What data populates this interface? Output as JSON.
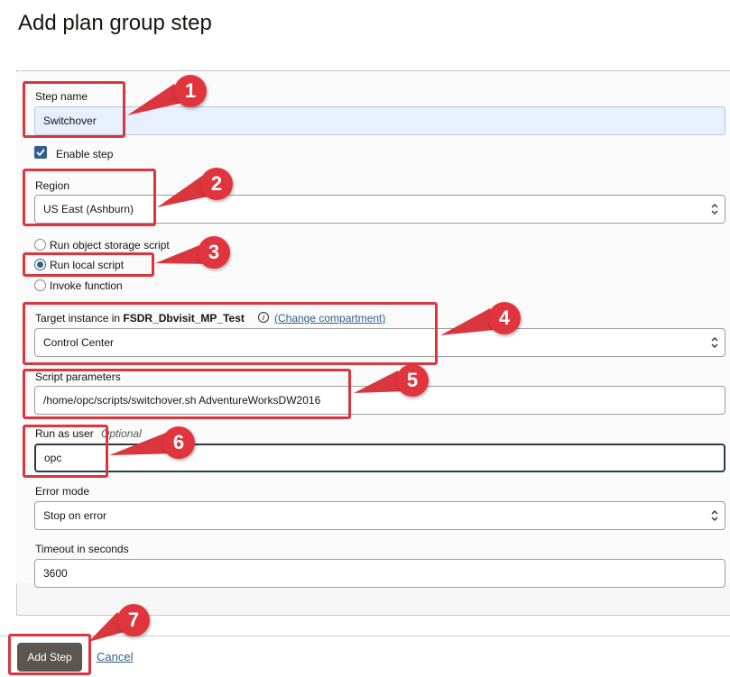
{
  "page_title": "Add plan group step",
  "form": {
    "step_name_label": "Step name",
    "step_name_value": "Switchover",
    "enable_step_label": "Enable step",
    "region_label": "Region",
    "region_value": "US East (Ashburn)",
    "radio_options": [
      "Run object storage script",
      "Run local script",
      "Invoke function"
    ],
    "target_instance_label": "Target instance in",
    "target_compartment": "FSDR_Dbvisit_MP_Test",
    "change_compartment_link": "(Change compartment)",
    "target_instance_value": "Control Center",
    "script_params_label": "Script parameters",
    "script_params_value": "/home/opc/scripts/switchover.sh AdventureWorksDW2016",
    "run_as_user_label": "Run as user",
    "run_as_user_optional": "Optional",
    "run_as_user_value": "opc",
    "error_mode_label": "Error mode",
    "error_mode_value": "Stop on error",
    "timeout_label": "Timeout in seconds",
    "timeout_value": "3600"
  },
  "footer": {
    "add_step_label": "Add Step",
    "cancel_label": "Cancel"
  },
  "callouts": [
    "1",
    "2",
    "3",
    "4",
    "5",
    "6",
    "7"
  ],
  "colors": {
    "annotation": "#d9363e",
    "primary_button": "#5b5652",
    "accent": "#2f5f8a"
  }
}
